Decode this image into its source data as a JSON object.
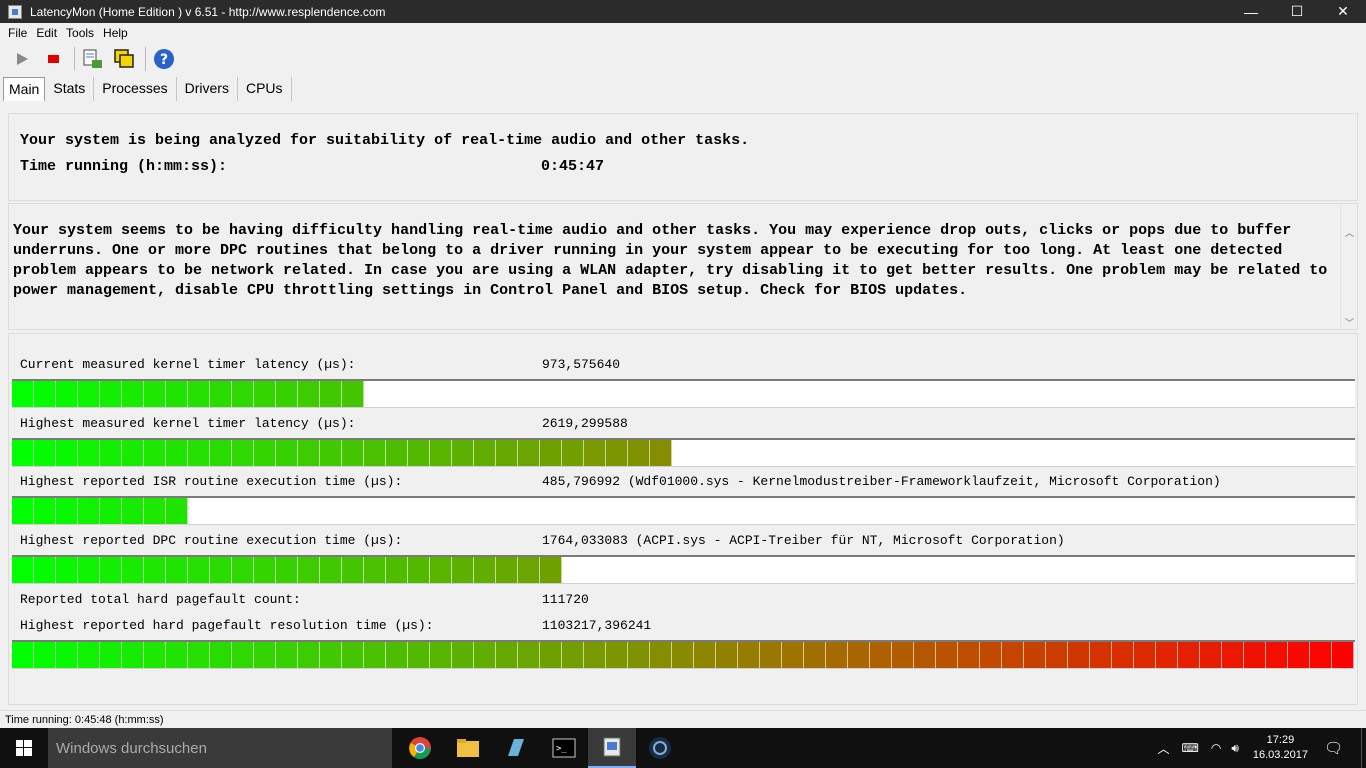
{
  "window": {
    "title": "LatencyMon  (Home Edition )  v 6.51 - http://www.resplendence.com",
    "minimize": "—",
    "maximize": "☐",
    "close": "✕"
  },
  "menu": {
    "file": "File",
    "edit": "Edit",
    "tools": "Tools",
    "help": "Help"
  },
  "tabs": {
    "main": "Main",
    "stats": "Stats",
    "processes": "Processes",
    "drivers": "Drivers",
    "cpus": "CPUs"
  },
  "analysis": {
    "line1": "Your system is being analyzed for suitability of real-time audio and other tasks.",
    "time_label": "Time running (h:mm:ss):",
    "time_value": "0:45:47"
  },
  "verdict": "Your system seems to be having difficulty handling real-time audio and other tasks. You may experience drop outs, clicks or pops due to buffer underruns. One or more DPC routines that belong to a driver running in your system appear to be executing for too long. At least one detected problem appears to be network related. In case you are using a WLAN adapter, try disabling it to get better results. One problem may be related to power management, disable CPU throttling settings in Control Panel and BIOS setup. Check for BIOS updates.",
  "metrics": {
    "current_latency": {
      "label": "Current measured kernel timer latency (µs):",
      "value": "973,575640",
      "level": 0.265
    },
    "highest_latency": {
      "label": "Highest measured kernel timer latency (µs):",
      "value": "2619,299588",
      "level": 0.484
    },
    "isr": {
      "label": "Highest reported ISR routine execution time (µs):",
      "value": "485,796992  (Wdf01000.sys - Kernelmodustreiber-Frameworklaufzeit, Microsoft Corporation)",
      "level": 0.13
    },
    "dpc": {
      "label": "Highest reported DPC routine execution time (µs):",
      "value": "1764,033083  (ACPI.sys - ACPI-Treiber für NT, Microsoft Corporation)",
      "level": 0.41
    },
    "pagefault_count": {
      "label": "Reported total hard pagefault count:",
      "value": "111720"
    },
    "pagefault_time": {
      "label": "Highest reported hard pagefault resolution time (µs):",
      "value": "1103217,396241",
      "level": 1.0
    }
  },
  "status": "Time running: 0:45:48  (h:mm:ss)",
  "taskbar": {
    "search_placeholder": "Windows durchsuchen",
    "time": "17:29",
    "date": "16.03.2017"
  },
  "colors": {
    "bar_start": "#00ff00",
    "bar_mid": "#8a8a00",
    "bar_end": "#ff0000",
    "titlebar": "#2b2b2b",
    "taskbar": "#101010"
  }
}
